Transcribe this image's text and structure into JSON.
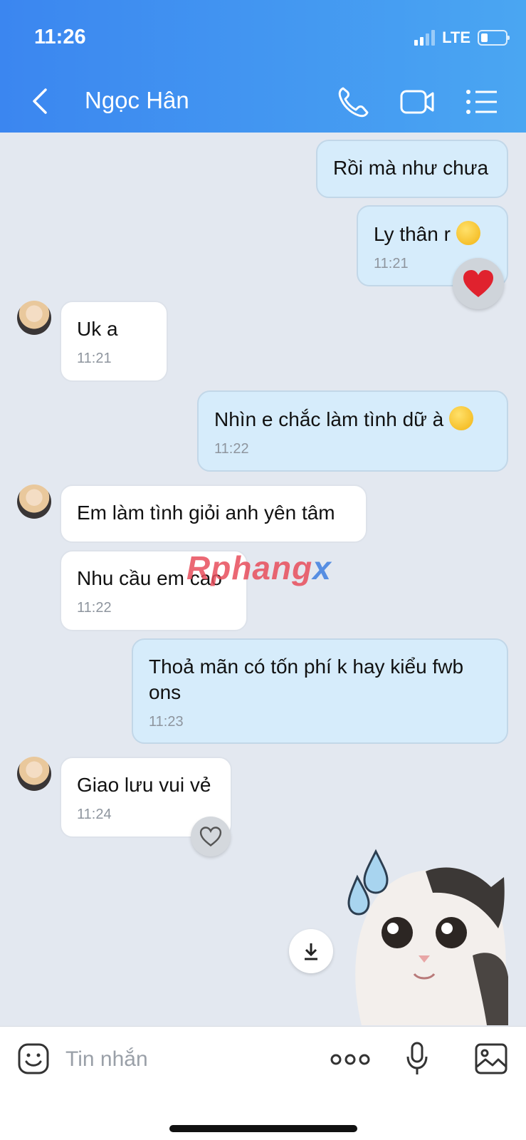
{
  "status": {
    "time": "11:26",
    "network": "LTE"
  },
  "header": {
    "contact_name": "Ngọc Hân"
  },
  "messages": [
    {
      "side": "out",
      "text": "Rồi mà như chưa",
      "time": ""
    },
    {
      "side": "out",
      "text": "Ly thân r",
      "time": "11:21",
      "emoji": "sly-face-emoji",
      "reaction": "heart"
    },
    {
      "side": "in",
      "text": "Uk a",
      "time": "11:21"
    },
    {
      "side": "out",
      "text": "Nhìn e chắc làm tình dữ à",
      "time": "11:22",
      "emoji": "thinking-face-emoji"
    },
    {
      "side": "in",
      "text": "Em làm tình giỏi anh yên tâm",
      "time": ""
    },
    {
      "side": "in",
      "text": "Nhu cầu em cao",
      "time": "11:22"
    },
    {
      "side": "out",
      "text": "Thoả mãn có tốn phí k hay kiểu fwb ons",
      "time": "11:23"
    },
    {
      "side": "in",
      "text": "Giao lưu vui vẻ",
      "time": "11:24",
      "reaction": "heart-outline"
    }
  ],
  "watermark": {
    "main": "Rphang",
    "accent": "x"
  },
  "input": {
    "placeholder": "Tin nhắn"
  },
  "colors": {
    "header_start": "#3b86f0",
    "header_end": "#4aa6f2",
    "outgoing_bubble": "#d6ecfb",
    "incoming_bubble": "#ffffff",
    "chat_bg": "#e3e8f0",
    "heart": "#e0222e"
  }
}
